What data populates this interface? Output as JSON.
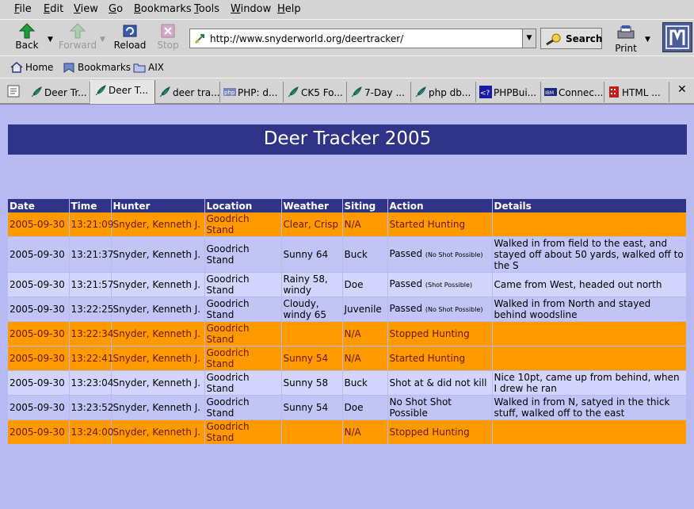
{
  "menubar": {
    "items": [
      {
        "key": "F",
        "rest": "ile"
      },
      {
        "key": "E",
        "rest": "dit"
      },
      {
        "key": "V",
        "rest": "iew"
      },
      {
        "key": "G",
        "rest": "o"
      },
      {
        "key": "B",
        "rest": "ookmarks"
      },
      {
        "key": "T",
        "rest": "ools"
      },
      {
        "key": "W",
        "rest": "indow"
      },
      {
        "key": "H",
        "rest": "elp"
      }
    ]
  },
  "navbar": {
    "back_label": "Back",
    "forward_label": "Forward",
    "reload_label": "Reload",
    "stop_label": "Stop",
    "url": "http://www.snyderworld.org/deertracker/",
    "search_label": "Search",
    "print_label": "Print"
  },
  "personalbar": {
    "home_label": "Home",
    "bookmarks_label": "Bookmarks",
    "aix_label": "AIX"
  },
  "tabs": [
    {
      "label": "Deer Tr...",
      "icon": "feather-icon"
    },
    {
      "label": "Deer T...",
      "icon": "feather-icon"
    },
    {
      "label": "deer tra...",
      "icon": "feather-icon"
    },
    {
      "label": "PHP: d...",
      "icon": "php-icon"
    },
    {
      "label": "CK5 Fo...",
      "icon": "feather-icon"
    },
    {
      "label": "7-Day ...",
      "icon": "feather-icon"
    },
    {
      "label": "php db...",
      "icon": "feather-icon"
    },
    {
      "label": "PHPBui...",
      "icon": "phpbuilder-icon"
    },
    {
      "label": "Connec...",
      "icon": "ibm-icon"
    },
    {
      "label": "HTML ...",
      "icon": "html-icon"
    }
  ],
  "page": {
    "title": "Deer Tracker 2005",
    "headers": [
      "Date",
      "Time",
      "Hunter",
      "Location",
      "Weather",
      "Siting",
      "Action",
      "Details"
    ],
    "rows": [
      {
        "style": "hi",
        "date": "2005-09-30",
        "time": "13:21:09",
        "hunter": "Snyder, Kenneth J.",
        "location": "Goodrich Stand",
        "weather": "Clear, Crisp",
        "siting": "N/A",
        "action": "Started Hunting",
        "note": "",
        "details": ""
      },
      {
        "style": "std",
        "date": "2005-09-30",
        "time": "13:21:37",
        "hunter": "Snyder, Kenneth J.",
        "location": "Goodrich Stand",
        "weather": "Sunny 64",
        "siting": "Buck",
        "action": "Passed",
        "note": "(No Shot Possible)",
        "details": "Walked in from field to the east, and stayed off about 50 yards, walked off to the S"
      },
      {
        "style": "alt",
        "date": "2005-09-30",
        "time": "13:21:57",
        "hunter": "Snyder, Kenneth J.",
        "location": "Goodrich Stand",
        "weather": "Rainy 58, windy",
        "siting": "Doe",
        "action": "Passed",
        "note": "(Shot Possible)",
        "details": "Came from West, headed out north"
      },
      {
        "style": "std",
        "date": "2005-09-30",
        "time": "13:22:25",
        "hunter": "Snyder, Kenneth J.",
        "location": "Goodrich Stand",
        "weather": "Cloudy, windy 65",
        "siting": "Juvenile",
        "action": "Passed",
        "note": "(No Shot Possible)",
        "details": "Walked in from North and stayed behind woodsline"
      },
      {
        "style": "hi",
        "date": "2005-09-30",
        "time": "13:22:34",
        "hunter": "Snyder, Kenneth J.",
        "location": "Goodrich Stand",
        "weather": "",
        "siting": "N/A",
        "action": "Stopped Hunting",
        "note": "",
        "details": ""
      },
      {
        "style": "hi",
        "date": "2005-09-30",
        "time": "13:22:41",
        "hunter": "Snyder, Kenneth J.",
        "location": "Goodrich Stand",
        "weather": "Sunny 54",
        "siting": "N/A",
        "action": "Started Hunting",
        "note": "",
        "details": ""
      },
      {
        "style": "alt",
        "date": "2005-09-30",
        "time": "13:23:04",
        "hunter": "Snyder, Kenneth J.",
        "location": "Goodrich Stand",
        "weather": "Sunny 58",
        "siting": "Buck",
        "action": "Shot at & did not kill",
        "note": "",
        "details": "Nice 10pt, came up from behind, when I drew he ran"
      },
      {
        "style": "std",
        "date": "2005-09-30",
        "time": "13:23:52",
        "hunter": "Snyder, Kenneth J.",
        "location": "Goodrich Stand",
        "weather": "Sunny 54",
        "siting": "Doe",
        "action": "No Shot Shot Possible",
        "note": "",
        "details": "Walked in from N, satyed in the thick stuff, walked off to the east"
      },
      {
        "style": "hi",
        "date": "2005-09-30",
        "time": "13:24:00",
        "hunter": "Snyder, Kenneth J.",
        "location": "Goodrich Stand",
        "weather": "",
        "siting": "N/A",
        "action": "Stopped Hunting",
        "note": "",
        "details": ""
      }
    ]
  },
  "colors": {
    "page_background": "#b7b9f2",
    "header_background": "#303489",
    "highlight_row": "#ff9900",
    "highlight_text": "#6a1800",
    "alt_row": "#d3d4fb",
    "standard_row": "#c2c4f6"
  }
}
